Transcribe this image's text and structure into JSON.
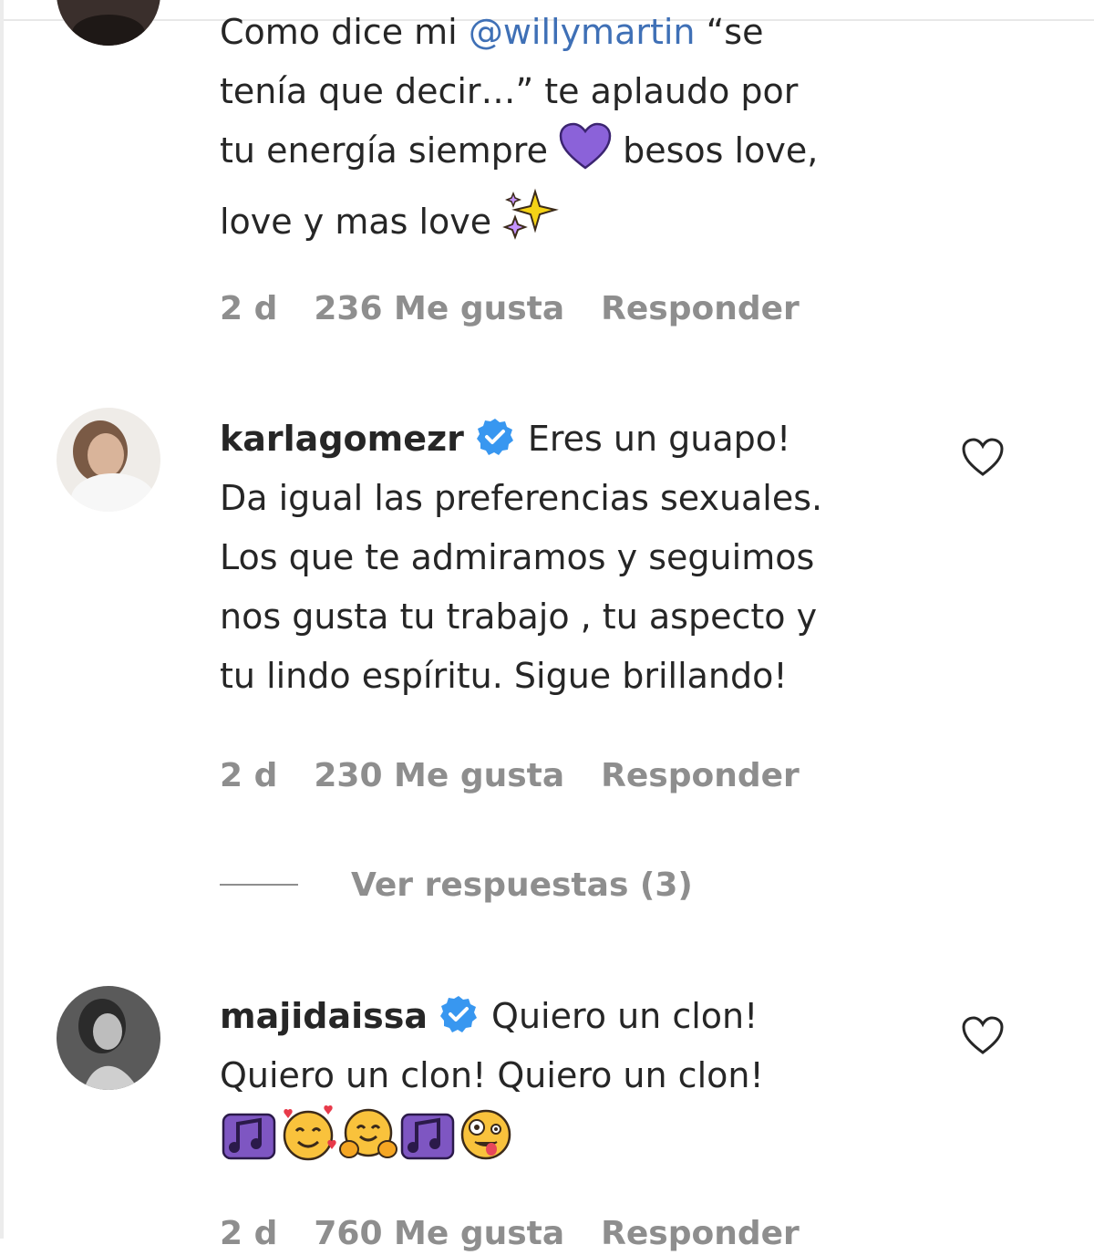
{
  "comments": [
    {
      "text_line1_pre": "Como dice mi ",
      "mention": "@willymartin",
      "text_line1_post": " “se",
      "text_line2": "tenía que decir…” te aplaudo por",
      "text_line3_pre": "tu energía siempre ",
      "text_line3_post": " besos love,",
      "text_line4": "love y mas love ",
      "emojis": [
        "purple-heart",
        "sparkles"
      ],
      "time": "2 d",
      "likes": "236 Me gusta",
      "reply": "Responder"
    },
    {
      "username": "karlagomezr",
      "verified": true,
      "text_line1": "Eres un guapo!",
      "text_line2": "Da igual las preferencias sexuales.",
      "text_line3": "Los que te admiramos y seguimos",
      "text_line4": "nos gusta tu trabajo , tu aspecto y",
      "text_line5": "tu lindo espíritu. Sigue brillando!",
      "time": "2 d",
      "likes": "230 Me gusta",
      "reply": "Responder",
      "view_replies": "Ver respuestas (3)"
    },
    {
      "username": "majidaissa",
      "verified": true,
      "text_line1": "Quiero un clon!",
      "text_line2": "Quiero un clon! Quiero un clon!",
      "emojis": [
        "musical-notes",
        "smiling-face-with-hearts",
        "hugging-face",
        "musical-notes",
        "zany-face"
      ],
      "time": "2 d",
      "likes": "760 Me gusta",
      "reply": "Responder"
    }
  ],
  "colors": {
    "text": "#262626",
    "secondary": "#8e8e8e",
    "mention": "#3f70b6",
    "verified": "#3897f0"
  },
  "icons": [
    "heart-outline-icon",
    "verified-badge-icon"
  ]
}
